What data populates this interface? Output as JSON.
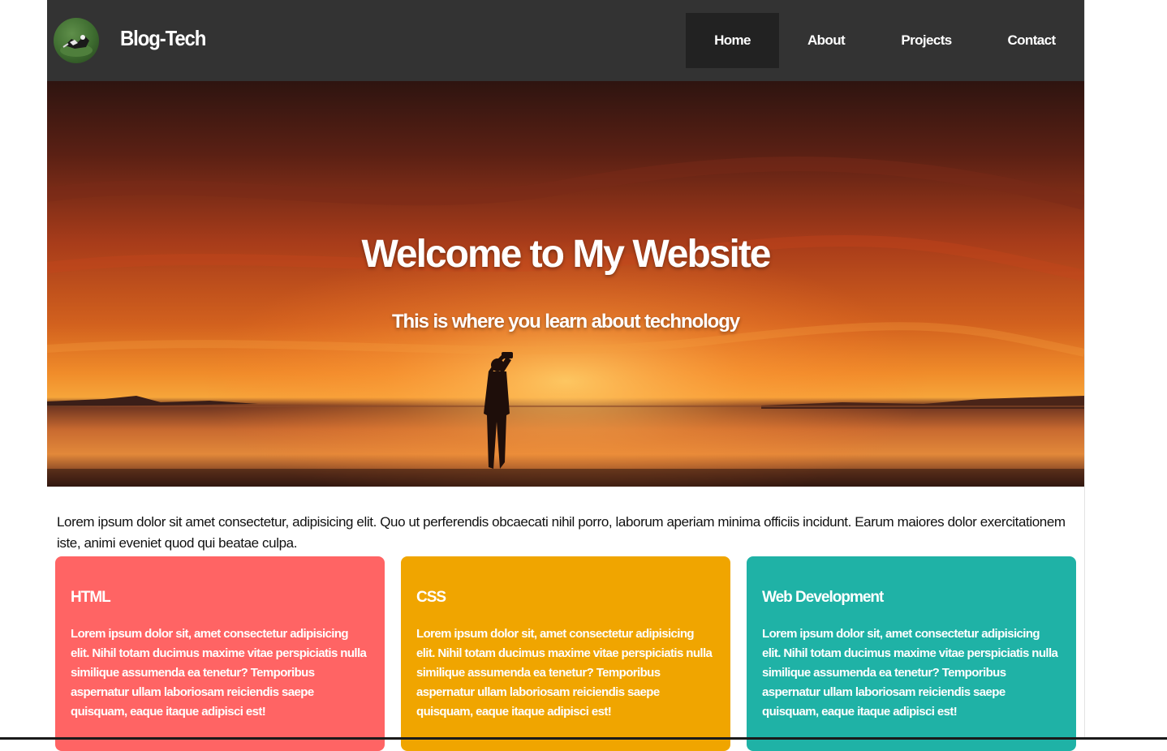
{
  "navbar": {
    "brand": "Blog-Tech",
    "logo_icon": "avatar-photo-icon",
    "links": [
      {
        "label": "Home",
        "active": true
      },
      {
        "label": "About",
        "active": false
      },
      {
        "label": "Projects",
        "active": false
      },
      {
        "label": "Contact",
        "active": false
      }
    ]
  },
  "hero": {
    "title": "Welcome to My Website",
    "subtitle": "This is where you learn about technology"
  },
  "intro": {
    "text": "Lorem ipsum dolor sit amet consectetur, adipisicing elit. Quo ut perferendis obcaecati nihil porro, laborum aperiam minima officiis incidunt. Earum maiores dolor exercitationem iste, animi eveniet quod qui beatae culpa."
  },
  "cards": [
    {
      "title": "HTML",
      "text": "Lorem ipsum dolor sit, amet consectetur adipisicing elit. Nihil totam ducimus maxime vitae perspiciatis nulla similique assumenda ea tenetur? Temporibus aspernatur ullam laboriosam reiciendis saepe quisquam, eaque itaque adipisci est!",
      "color": "#ff6464"
    },
    {
      "title": "CSS",
      "text": "Lorem ipsum dolor sit, amet consectetur adipisicing elit. Nihil totam ducimus maxime vitae perspiciatis nulla similique assumenda ea tenetur? Temporibus aspernatur ullam laboriosam reiciendis saepe quisquam, eaque itaque adipisci est!",
      "color": "#f0a500"
    },
    {
      "title": "Web Development",
      "text": "Lorem ipsum dolor sit, amet consectetur adipisicing elit. Nihil totam ducimus maxime vitae perspiciatis nulla similique assumenda ea tenetur? Temporibus aspernatur ullam laboriosam reiciendis saepe quisquam, eaque itaque adipisci est!",
      "color": "#1fb2a6"
    }
  ],
  "colors": {
    "navbar_bg": "#333333",
    "nav_active_bg": "#222222"
  }
}
